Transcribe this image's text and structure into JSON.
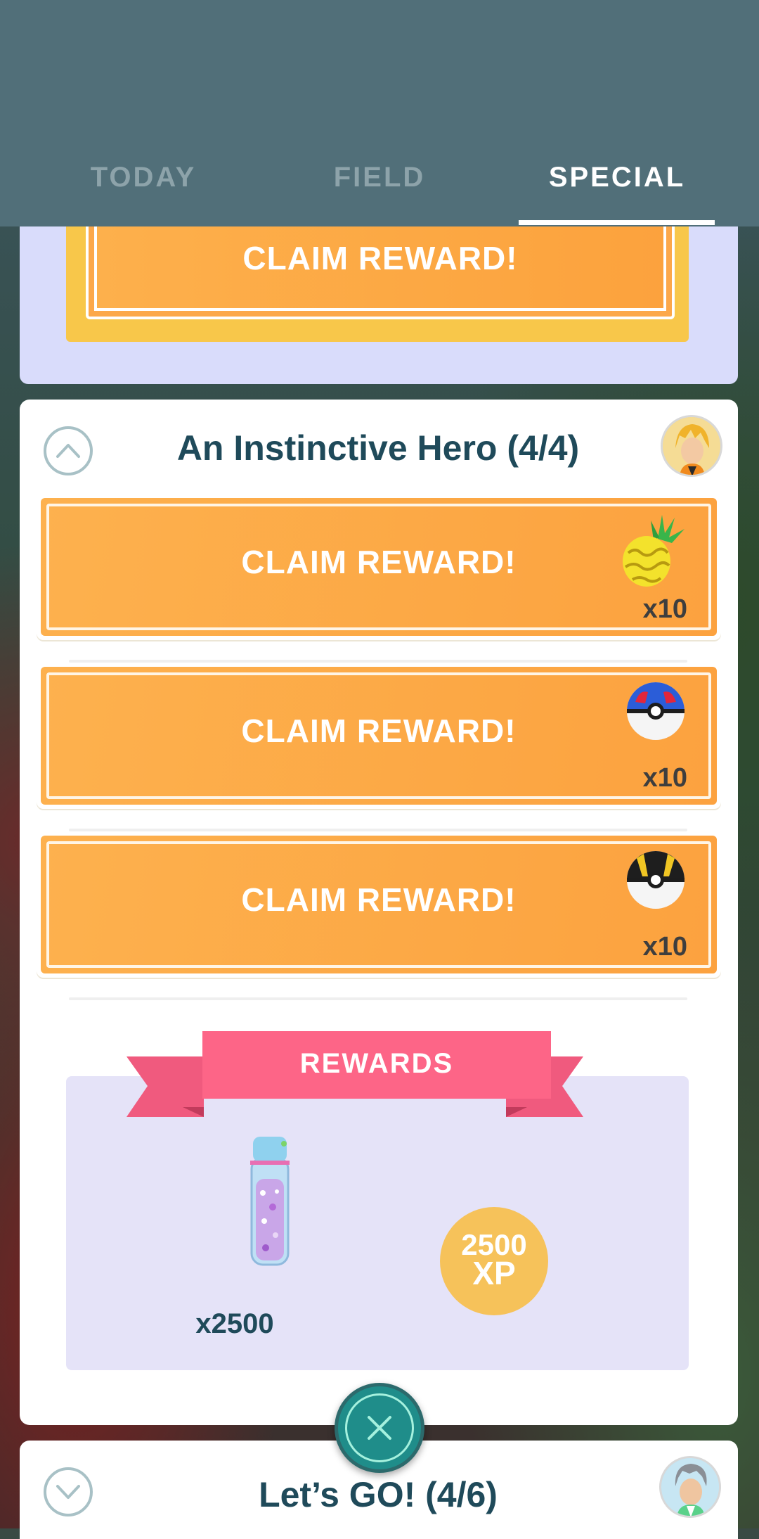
{
  "tabs": [
    {
      "label": "TODAY",
      "active": false
    },
    {
      "label": "FIELD",
      "active": false
    },
    {
      "label": "SPECIAL",
      "active": true
    }
  ],
  "top_card": {
    "claim_label": "CLAIM REWARD!"
  },
  "main_card": {
    "title": "An Instinctive Hero (4/4)",
    "avatar_icon": "spark-avatar",
    "tasks": [
      {
        "label": "CLAIM REWARD!",
        "reward_icon": "golden-pinap-berry-icon",
        "quantity": "x10"
      },
      {
        "label": "CLAIM REWARD!",
        "reward_icon": "great-ball-icon",
        "quantity": "x10"
      },
      {
        "label": "CLAIM REWARD!",
        "reward_icon": "ultra-ball-icon",
        "quantity": "x10"
      }
    ],
    "rewards": {
      "ribbon_label": "REWARDS",
      "stardust_quantity": "x2500",
      "xp_value": "2500",
      "xp_unit": "XP"
    }
  },
  "bottom_card": {
    "title": "Let’s GO! (4/6)",
    "avatar_icon": "professor-willow-avatar"
  },
  "colors": {
    "header": "#516f79",
    "claim_orange": "#fca23f",
    "ribbon_pink": "#fd6587",
    "xp_gold": "#f6c25a",
    "close_teal": "#1f8d8a",
    "title_text": "#1f4a5a"
  }
}
